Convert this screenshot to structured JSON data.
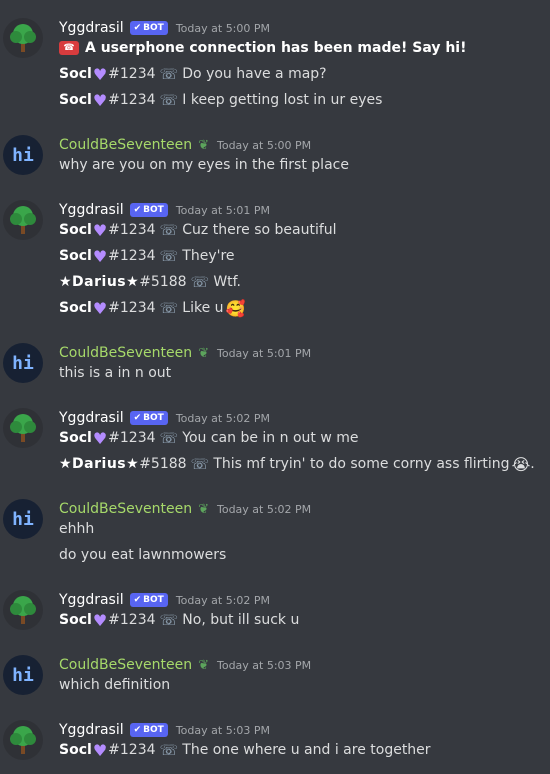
{
  "channel": {
    "bot_tag": "BOT",
    "groups": [
      {
        "author": "Yggdrasil",
        "is_bot": true,
        "avatar": "tree-avatar",
        "timestamp": "Today at 5:00 PM",
        "messages": [
          {
            "type": "system",
            "text": "A userphone connection has been made! Say hi!"
          },
          {
            "type": "relay",
            "sender": "Socl",
            "disc": "#1234",
            "text": "Do you have a map?"
          },
          {
            "type": "relay",
            "sender": "Socl",
            "disc": "#1234",
            "text": "I keep getting lost in ur eyes"
          }
        ]
      },
      {
        "author": "CouldBeSeventeen",
        "is_bot": false,
        "avatar": "hi-avatar",
        "timestamp": "Today at 5:00 PM",
        "messages": [
          {
            "type": "text",
            "text": "why are you on my eyes in the first place"
          }
        ]
      },
      {
        "author": "Yggdrasil",
        "is_bot": true,
        "avatar": "tree-avatar",
        "timestamp": "Today at 5:01 PM",
        "messages": [
          {
            "type": "relay",
            "sender": "Socl",
            "disc": "#1234",
            "text": "Cuz there so beautiful"
          },
          {
            "type": "relay",
            "sender": "Socl",
            "disc": "#1234",
            "text": "They're"
          },
          {
            "type": "relay",
            "sender": "★Darius★",
            "disc": "#5188",
            "text": "Wtf."
          },
          {
            "type": "relay",
            "sender": "Socl",
            "disc": "#1234",
            "text": "Like u",
            "emoji": "🥰"
          }
        ]
      },
      {
        "author": "CouldBeSeventeen",
        "is_bot": false,
        "avatar": "hi-avatar",
        "timestamp": "Today at 5:01 PM",
        "messages": [
          {
            "type": "text",
            "text": "this is a in n out"
          }
        ]
      },
      {
        "author": "Yggdrasil",
        "is_bot": true,
        "avatar": "tree-avatar",
        "timestamp": "Today at 5:02 PM",
        "messages": [
          {
            "type": "relay",
            "sender": "Socl",
            "disc": "#1234",
            "text": "You can be in n out w me"
          },
          {
            "type": "relay",
            "sender": "★Darius★",
            "disc": "#5188",
            "text": "This mf tryin' to do some corny ass flirting",
            "emoji": "😭",
            "suffix": "."
          }
        ]
      },
      {
        "author": "CouldBeSeventeen",
        "is_bot": false,
        "avatar": "hi-avatar",
        "timestamp": "Today at 5:02 PM",
        "messages": [
          {
            "type": "text",
            "text": "ehhh"
          },
          {
            "type": "text",
            "text": "do you eat lawnmowers"
          }
        ]
      },
      {
        "author": "Yggdrasil",
        "is_bot": true,
        "avatar": "tree-avatar",
        "timestamp": "Today at 5:02 PM",
        "messages": [
          {
            "type": "relay",
            "sender": "Socl",
            "disc": "#1234",
            "text": "No, but ill suck u"
          }
        ]
      },
      {
        "author": "CouldBeSeventeen",
        "is_bot": false,
        "avatar": "hi-avatar",
        "timestamp": "Today at 5:03 PM",
        "messages": [
          {
            "type": "text",
            "text": "which definition"
          }
        ]
      },
      {
        "author": "Yggdrasil",
        "is_bot": true,
        "avatar": "tree-avatar",
        "timestamp": "Today at 5:03 PM",
        "messages": [
          {
            "type": "relay",
            "sender": "Socl",
            "disc": "#1234",
            "text": "The one where u and i are together"
          }
        ]
      }
    ]
  },
  "colors": {
    "background": "#36393f",
    "bot_tag": "#5865f2",
    "user_name": "#a6d96a",
    "heart": "#b48cff"
  }
}
